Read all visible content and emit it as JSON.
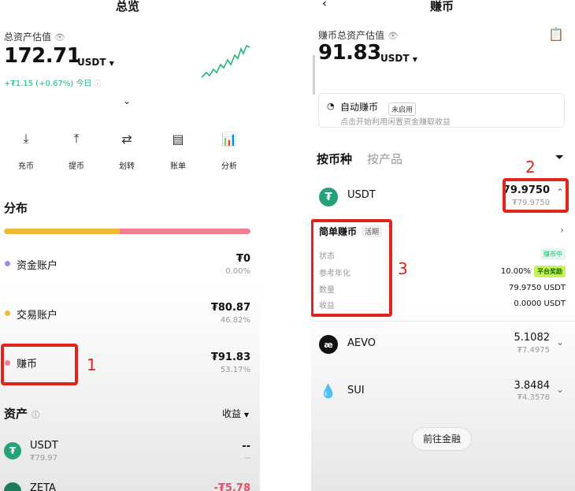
{
  "left": {
    "title": "总览",
    "total_label": "总资产估值",
    "total_value": "172.71",
    "currency": "USDT",
    "change_text": "+₮1.15 (+0.67%) 今日",
    "actions": [
      {
        "label": "充币",
        "icon": "deposit-icon"
      },
      {
        "label": "提币",
        "icon": "withdraw-icon"
      },
      {
        "label": "划转",
        "icon": "transfer-icon"
      },
      {
        "label": "账单",
        "icon": "bill-icon"
      },
      {
        "label": "分析",
        "icon": "analysis-icon"
      }
    ],
    "distribution_title": "分布",
    "distribution_yellow_fraction": 0.47,
    "accounts": [
      {
        "name": "资金账户",
        "value": "₮0",
        "pct": "0.00%",
        "color": "#9b8cf0"
      },
      {
        "name": "交易账户",
        "value": "₮80.87",
        "pct": "46.82%",
        "color": "#f0b83a"
      },
      {
        "name": "赚币",
        "value": "₮91.83",
        "pct": "53.17%",
        "color": "#ef8190"
      }
    ],
    "assets_title": "资产",
    "assets_sort": "收益",
    "assets": [
      {
        "name": "USDT",
        "sub": "₮79.97",
        "value": "--",
        "value2": "--"
      },
      {
        "name": "ZETA",
        "value": "-₮5.78"
      }
    ],
    "annotation_1": "1"
  },
  "right": {
    "title": "赚币",
    "total_label": "赚币总资产估值",
    "total_value": "91.83",
    "currency": "USDT",
    "auto_title": "自动赚币",
    "auto_badge": "未启用",
    "auto_desc": "点击开始利用闲置资金赚取收益",
    "tab_active": "按币种",
    "tab_inactive": "按产品",
    "usdt": {
      "name": "USDT",
      "amount": "79.9750",
      "sub": "₮79.9750"
    },
    "simple_title": "简单赚币",
    "simple_badge": "活期",
    "details": [
      {
        "k": "状态",
        "v": "赚币中"
      },
      {
        "k": "参考年化",
        "v": "10.00%",
        "tag": "平台奖励"
      },
      {
        "k": "数量",
        "v": "79.9750 USDT"
      },
      {
        "k": "收益",
        "v": "0.0000 USDT"
      }
    ],
    "coins": [
      {
        "name": "AEVO",
        "amount": "5.1082",
        "sub": "₮7.4975"
      },
      {
        "name": "SUI",
        "amount": "3.8484",
        "sub": "₮4.3578"
      }
    ],
    "go_button": "前往金融",
    "annotation_2": "2",
    "annotation_3": "3"
  },
  "colors": {
    "accent_green": "#1fb978",
    "annotation_red": "#e2231a",
    "usdt_green": "#26a17b"
  }
}
